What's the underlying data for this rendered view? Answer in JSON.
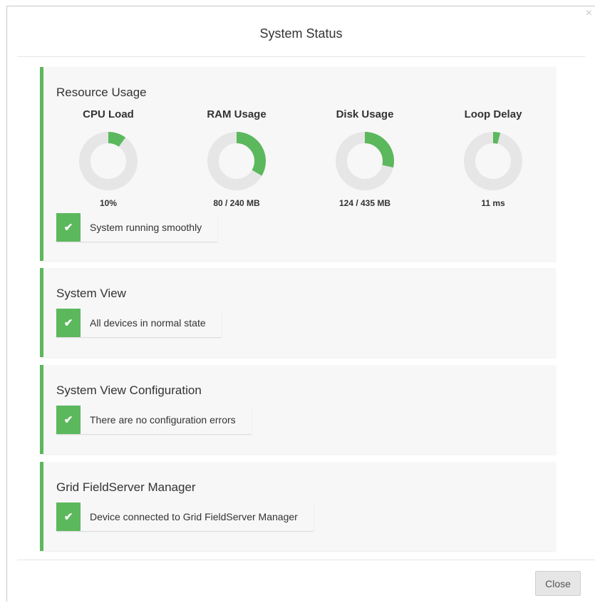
{
  "modal": {
    "title": "System Status",
    "close_glyph": "×",
    "close_button": "Close"
  },
  "colors": {
    "accent": "#5cb85c",
    "track": "#e6e6e6",
    "card_bg": "#f7f7f7"
  },
  "resource_usage": {
    "title": "Resource Usage",
    "gauges": [
      {
        "label": "CPU Load",
        "value": "10%",
        "fraction": 0.1
      },
      {
        "label": "RAM Usage",
        "value": "80 / 240 MB",
        "fraction": 0.3333
      },
      {
        "label": "Disk Usage",
        "value": "124 / 435 MB",
        "fraction": 0.285
      },
      {
        "label": "Loop Delay",
        "value": "11 ms",
        "fraction": 0.04
      }
    ],
    "status": {
      "icon": "check-icon",
      "text": "System running smoothly"
    }
  },
  "system_view": {
    "title": "System View",
    "status": {
      "icon": "check-icon",
      "text": "All devices in normal state"
    }
  },
  "system_view_configuration": {
    "title": "System View Configuration",
    "status": {
      "icon": "check-icon",
      "text": "There are no configuration errors"
    }
  },
  "grid_manager": {
    "title": "Grid FieldServer Manager",
    "status": {
      "icon": "check-icon",
      "text": "Device connected to Grid FieldServer Manager"
    }
  }
}
